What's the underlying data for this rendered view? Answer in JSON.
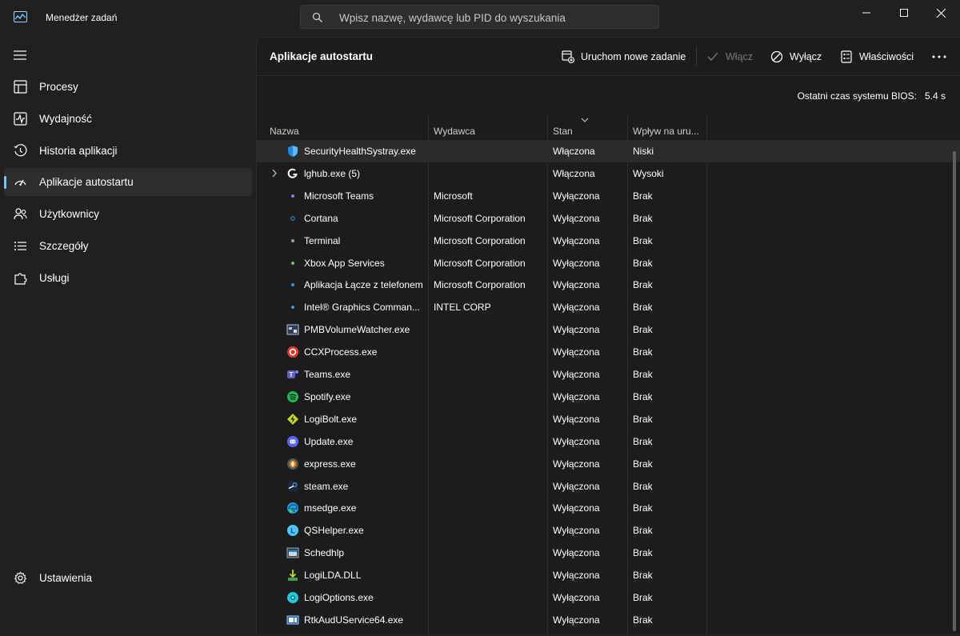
{
  "titlebar": {
    "app_title": "Menedżer zadań",
    "search_placeholder": "Wpisz nazwę, wydawcę lub PID do wyszukania"
  },
  "sidebar": {
    "items": [
      {
        "label": "Procesy",
        "icon": "processes-grid-icon"
      },
      {
        "label": "Wydajność",
        "icon": "performance-pulse-icon"
      },
      {
        "label": "Historia aplikacji",
        "icon": "history-clock-icon"
      },
      {
        "label": "Aplikacje autostartu",
        "icon": "speedometer-icon",
        "active": true
      },
      {
        "label": "Użytkownicy",
        "icon": "users-icon"
      },
      {
        "label": "Szczegóły",
        "icon": "details-list-icon"
      },
      {
        "label": "Usługi",
        "icon": "services-puzzle-icon"
      }
    ],
    "settings_label": "Ustawienia"
  },
  "main": {
    "title": "Aplikacje autostartu",
    "toolbar": {
      "new_task": "Uruchom nowe zadanie",
      "enable": "Włącz",
      "disable": "Wyłącz",
      "properties": "Właściwości"
    },
    "bios_label": "Ostatni czas systemu BIOS:",
    "bios_value": "5.4 s"
  },
  "table": {
    "columns": [
      "Nazwa",
      "Wydawca",
      "Stan",
      "Wpływ na uru..."
    ],
    "rows": [
      {
        "name": "SecurityHealthSystray.exe",
        "publisher": "",
        "state": "Włączona",
        "impact": "Niski",
        "icon": "shield-icon",
        "color": "#1e88e5"
      },
      {
        "name": "lghub.exe (5)",
        "publisher": "",
        "state": "Włączona",
        "impact": "Wysoki",
        "icon": "logitech-g-icon",
        "color": "#ffffff"
      },
      {
        "name": "Microsoft Teams",
        "publisher": "Microsoft",
        "state": "Wyłączona",
        "impact": "Brak",
        "icon": "dot-icon",
        "color": "#7b83eb"
      },
      {
        "name": "Cortana",
        "publisher": "Microsoft Corporation",
        "state": "Wyłączona",
        "impact": "Brak",
        "icon": "ring-icon",
        "color": "#3a96dd"
      },
      {
        "name": "Terminal",
        "publisher": "Microsoft Corporation",
        "state": "Wyłączona",
        "impact": "Brak",
        "icon": "dot-icon",
        "color": "#9e9e9e"
      },
      {
        "name": "Xbox App Services",
        "publisher": "Microsoft Corporation",
        "state": "Wyłączona",
        "impact": "Brak",
        "icon": "dot-icon",
        "color": "#6ccb5f"
      },
      {
        "name": "Aplikacja Łącze z telefonem",
        "publisher": "Microsoft Corporation",
        "state": "Wyłączona",
        "impact": "Brak",
        "icon": "dot-icon",
        "color": "#3a96dd"
      },
      {
        "name": "Intel® Graphics Comman...",
        "publisher": "INTEL CORP",
        "state": "Wyłączona",
        "impact": "Brak",
        "icon": "dot-icon",
        "color": "#3a96dd"
      },
      {
        "name": "PMBVolumeWatcher.exe",
        "publisher": "",
        "state": "Wyłączona",
        "impact": "Brak",
        "icon": "app-window-icon",
        "color": "#b0c4de"
      },
      {
        "name": "CCXProcess.exe",
        "publisher": "",
        "state": "Wyłączona",
        "impact": "Brak",
        "icon": "adobe-cc-icon",
        "color": "#e53935"
      },
      {
        "name": "Teams.exe",
        "publisher": "",
        "state": "Wyłączona",
        "impact": "Brak",
        "icon": "teams-icon",
        "color": "#5b5fc7"
      },
      {
        "name": "Spotify.exe",
        "publisher": "",
        "state": "Wyłączona",
        "impact": "Brak",
        "icon": "spotify-icon",
        "color": "#1db954"
      },
      {
        "name": "LogiBolt.exe",
        "publisher": "",
        "state": "Wyłączona",
        "impact": "Brak",
        "icon": "logibolt-icon",
        "color": "#c6d826"
      },
      {
        "name": "Update.exe",
        "publisher": "",
        "state": "Wyłączona",
        "impact": "Brak",
        "icon": "discord-icon",
        "color": "#5865f2"
      },
      {
        "name": "express.exe",
        "publisher": "",
        "state": "Wyłączona",
        "impact": "Brak",
        "icon": "express-icon",
        "color": "#f57c00"
      },
      {
        "name": "steam.exe",
        "publisher": "",
        "state": "Wyłączona",
        "impact": "Brak",
        "icon": "steam-icon",
        "color": "#4c8cc8"
      },
      {
        "name": "msedge.exe",
        "publisher": "",
        "state": "Wyłączona",
        "impact": "Brak",
        "icon": "edge-icon",
        "color": "#1fa0e0"
      },
      {
        "name": "QSHelper.exe",
        "publisher": "",
        "state": "Wyłączona",
        "impact": "Brak",
        "icon": "qshelper-icon",
        "color": "#4fc3f7"
      },
      {
        "name": "Schedhlp",
        "publisher": "",
        "state": "Wyłączona",
        "impact": "Brak",
        "icon": "schedhlp-icon",
        "color": "#90a4ae"
      },
      {
        "name": "LogiLDA.DLL",
        "publisher": "",
        "state": "Wyłączona",
        "impact": "Brak",
        "icon": "download-icon",
        "color": "#43a047"
      },
      {
        "name": "LogiOptions.exe",
        "publisher": "",
        "state": "Wyłączona",
        "impact": "Brak",
        "icon": "logioptions-icon",
        "color": "#26c6da"
      },
      {
        "name": "RtkAudUService64.exe",
        "publisher": "",
        "state": "Wyłączona",
        "impact": "Brak",
        "icon": "realtek-icon",
        "color": "#1e63b6"
      }
    ]
  },
  "colors": {
    "accent": "#60cdff",
    "window_bg": "#202020",
    "panel_bg": "#1c1c1c",
    "selected_row": "#2b2b2b"
  }
}
